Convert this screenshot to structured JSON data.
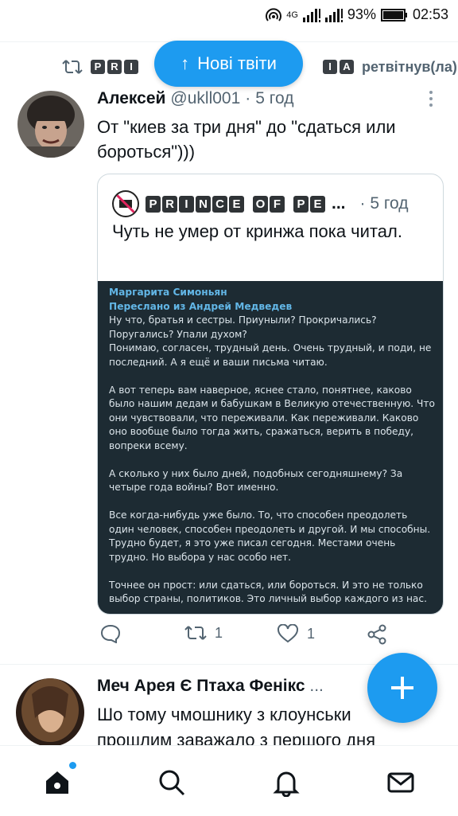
{
  "status_bar": {
    "network": "4G",
    "battery": "93%",
    "time": "02:53"
  },
  "retweet_banner": {
    "name_blocks_visible": [
      "P",
      "R",
      "I"
    ],
    "name_blocks_tail": [
      "I",
      "A"
    ],
    "label": "ретвітнув(ла)"
  },
  "new_tweets_pill": {
    "label": "Нові твіти",
    "icon": "arrow-up-icon"
  },
  "tweet": {
    "author_name": "Алексей",
    "handle": "@ukll001",
    "separator": "·",
    "age": "5 год",
    "text": "От \"киев за три дня\" до \"сдаться или бороться\")))",
    "quote": {
      "name_words": [
        "PRINCE",
        "OF",
        "PE"
      ],
      "ellipsis": "...",
      "age": "· 5 год",
      "text": "Чуть не умер от кринжа пока читал.",
      "image_message": {
        "sender": "Маргарита Симоньян",
        "forwarded": "Переслано из Андрей Медведев",
        "paragraphs": [
          "Ну что, братья и сестры. Приуныли? Прокричались? Поругались? Упали духом?\nПонимаю, согласен, трудный день. Очень трудный, и поди, не последний. А я ещё и ваши письма читаю.",
          "А вот теперь вам наверное,  яснее стало, понятнее, каково было нашим дедам и бабушкам в Великую отечественную. Что они чувствовали, что переживали. Как переживали. Каково оно вообще было тогда жить, сражаться, верить в победу, вопреки всему.",
          "А сколько у них было дней, подобных сегодняшнему? За четыре года войны? Вот именно.",
          "Все когда-нибудь уже было. То, что способен преодолеть один человек, способен преодолеть и другой. И мы способны. Трудно будет, я это уже писал сегодня. Местами очень трудно. Но выбора у нас особо нет.",
          "Точнее он прост: или сдаться, или бороться. И это не только выбор страны, политиков. Это личный выбор каждого из нас."
        ]
      }
    },
    "actions": {
      "reply_icon": "reply-icon",
      "retweet_count": "1",
      "like_count": "1",
      "share_icon": "share-icon"
    }
  },
  "tweet2": {
    "author_name": "Меч Арея",
    "author_tail": "Птаха Фенікс",
    "ellipsis": "...",
    "text_line1": "Шо тому чмошнику з клоунськи",
    "text_line2": "прошлим заважало з першого дня"
  },
  "bottom_nav": {
    "items": [
      "home-icon",
      "search-icon",
      "notifications-icon",
      "messages-icon"
    ]
  },
  "colors": {
    "accent": "#1d9bf0",
    "secondary_text": "#536471",
    "image_bg": "#1d2b33"
  }
}
